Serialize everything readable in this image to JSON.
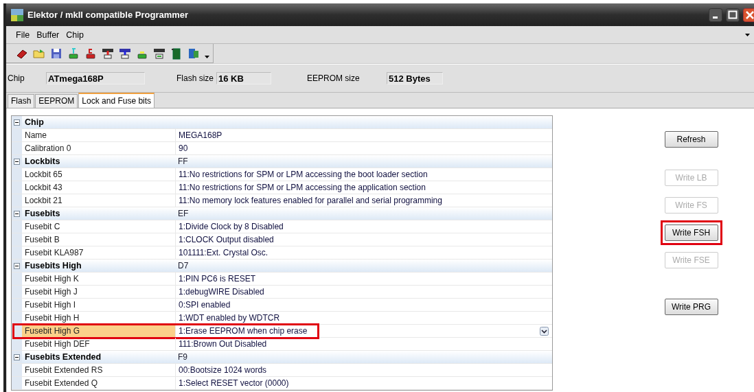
{
  "window": {
    "title": "Elektor / mkII compatible Programmer"
  },
  "menu": [
    "File",
    "Buffer",
    "Chip"
  ],
  "chip_info": [
    {
      "label": "Chip",
      "value": "ATmega168P"
    },
    {
      "label": "Flash size",
      "value": "16 KB"
    },
    {
      "label": "EEPROM size",
      "value": "512 Bytes"
    }
  ],
  "tabs": [
    {
      "label": "Flash",
      "selected": false
    },
    {
      "label": "EEPROM",
      "selected": false
    },
    {
      "label": "Lock and Fuse bits",
      "selected": true
    }
  ],
  "grid": {
    "groups": [
      {
        "name": "Chip",
        "expanded": true,
        "rows": [
          {
            "name": "Name",
            "value": "MEGA168P",
            "selected": false,
            "highlighted": false
          },
          {
            "name": "Calibration 0",
            "value": "90",
            "selected": false,
            "highlighted": false
          }
        ]
      },
      {
        "name": "Lockbits",
        "value": "FF",
        "expanded": true,
        "rows": [
          {
            "name": "Lockbit 65",
            "value": "11:No restrictions for SPM or LPM accessing the boot loader section",
            "selected": false,
            "highlighted": false
          },
          {
            "name": "Lockbit 43",
            "value": "11:No restrictions for SPM or LPM accessing the application section",
            "selected": false,
            "highlighted": false
          },
          {
            "name": "Lockbit 21",
            "value": "11:No memory lock features enabled for parallel and serial programming",
            "selected": false,
            "highlighted": false
          }
        ]
      },
      {
        "name": "Fusebits",
        "value": "EF",
        "expanded": true,
        "rows": [
          {
            "name": "Fusebit C",
            "value": "1:Divide Clock by 8 Disabled",
            "selected": false,
            "highlighted": false
          },
          {
            "name": "Fusebit B",
            "value": "1:CLOCK Output disabled",
            "selected": false,
            "highlighted": false
          },
          {
            "name": "Fusebit KLA987",
            "value": "101111:Ext. Crystal Osc.",
            "selected": false,
            "highlighted": false
          }
        ]
      },
      {
        "name": "Fusebits High",
        "value": "D7",
        "expanded": true,
        "rows": [
          {
            "name": "Fusebit High K",
            "value": "1:PIN PC6 is RESET",
            "selected": false,
            "highlighted": false
          },
          {
            "name": "Fusebit High J",
            "value": "1:debugWIRE Disabled",
            "selected": false,
            "highlighted": false
          },
          {
            "name": "Fusebit High I",
            "value": "0:SPI enabled",
            "selected": false,
            "highlighted": false
          },
          {
            "name": "Fusebit High H",
            "value": "1:WDT enabled by WDTCR",
            "selected": false,
            "highlighted": false
          },
          {
            "name": "Fusebit High G",
            "value": "1:Erase EEPROM when chip erase",
            "selected": true,
            "highlighted": true
          },
          {
            "name": "Fusebit High DEF",
            "value": "111:Brown Out Disabled",
            "selected": false,
            "highlighted": false
          }
        ]
      },
      {
        "name": "Fusebits Extended",
        "value": "F9",
        "expanded": true,
        "rows": [
          {
            "name": "Fusebit Extended RS",
            "value": "00:Bootsize 1024 words",
            "selected": false,
            "highlighted": false
          },
          {
            "name": "Fusebit Extended Q",
            "value": "1:Select RESET vector (0000)",
            "selected": false,
            "highlighted": false
          }
        ]
      }
    ]
  },
  "button_groups": [
    [
      {
        "label": "Refresh",
        "disabled": false,
        "highlighted": false
      }
    ],
    [
      {
        "label": "Write LB",
        "disabled": true,
        "highlighted": false
      },
      {
        "label": "Write FS",
        "disabled": true,
        "highlighted": false
      },
      {
        "label": "Write FSH",
        "disabled": false,
        "highlighted": true
      },
      {
        "label": "Write FSE",
        "disabled": true,
        "highlighted": false
      }
    ],
    [
      {
        "label": "Write PRG",
        "disabled": false,
        "highlighted": false
      }
    ]
  ]
}
